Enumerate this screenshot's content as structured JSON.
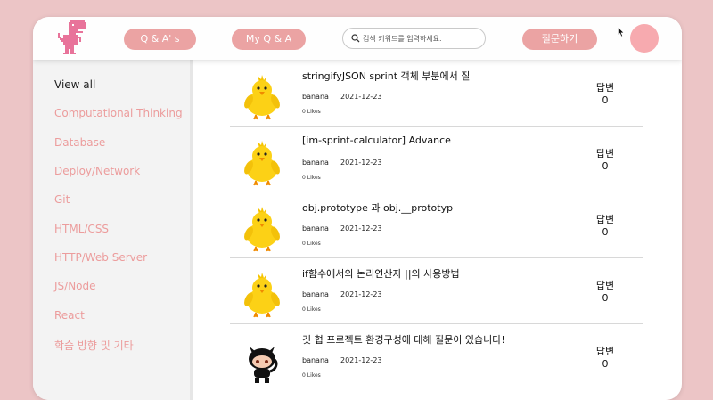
{
  "header": {
    "qa_button": "Q & A' s",
    "my_qa_button": "My Q & A",
    "search_placeholder": "검색 키워드를 입력하세요.",
    "ask_button": "질문하기"
  },
  "sidebar": {
    "items": [
      {
        "label": "View all",
        "active": true
      },
      {
        "label": "Computational Thinking",
        "active": false
      },
      {
        "label": "Database",
        "active": false
      },
      {
        "label": "Deploy/Network",
        "active": false
      },
      {
        "label": "Git",
        "active": false
      },
      {
        "label": "HTML/CSS",
        "active": false
      },
      {
        "label": "HTTP/Web Server",
        "active": false
      },
      {
        "label": "JS/Node",
        "active": false
      },
      {
        "label": "React",
        "active": false
      },
      {
        "label": "학습 방향 및 기타",
        "active": false
      }
    ]
  },
  "questions": [
    {
      "title": "stringifyJSON sprint 객체 부분에서 질",
      "author": "banana",
      "date": "2021-12-23",
      "likes": "0 Likes",
      "answer_label": "답변",
      "answer_count": "0",
      "avatar": "chick-icon"
    },
    {
      "title": "[im-sprint-calculator] Advance",
      "author": "banana",
      "date": "2021-12-23",
      "likes": "0 Likes",
      "answer_label": "답변",
      "answer_count": "0",
      "avatar": "chick-icon"
    },
    {
      "title": "obj.prototype 과 obj.__prototyp",
      "author": "banana",
      "date": "2021-12-23",
      "likes": "0 Likes",
      "answer_label": "답변",
      "answer_count": "0",
      "avatar": "chick-icon"
    },
    {
      "title": "if함수에서의 논리연산자 ||의 사용방법",
      "author": "banana",
      "date": "2021-12-23",
      "likes": "0 Likes",
      "answer_label": "답변",
      "answer_count": "0",
      "avatar": "chick-icon"
    },
    {
      "title": "깃 협 프로젝트 환경구성에 대해 질문이 있습니다!",
      "author": "banana",
      "date": "2021-12-23",
      "likes": "0 Likes",
      "answer_label": "답변",
      "answer_count": "0",
      "avatar": "octocat-icon"
    }
  ],
  "colors": {
    "accent": "#eba3a3",
    "sidebar_text": "#ec9c9c",
    "avatar": "#f7aaaf",
    "page_bg": "#ecc5c6"
  }
}
